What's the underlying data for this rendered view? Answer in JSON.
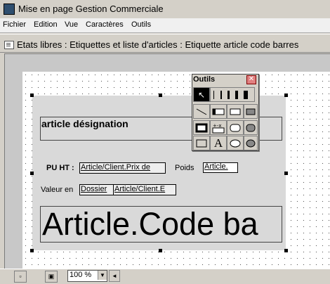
{
  "app": {
    "title": "Mise en page Gestion Commerciale"
  },
  "menu": [
    "Fichier",
    "Edition",
    "Vue",
    "Caractères",
    "Outils"
  ],
  "document": {
    "title": "Etats libres : Etiquettes et liste d'articles : Etiquette article code barres"
  },
  "label": {
    "designation": "article désignation",
    "puht_label": "PU HT :",
    "prix_field": "Article/Client.Prix de",
    "poids_label": "Poids",
    "poids_field": "Article.",
    "valeur_label": "Valeur en",
    "dossier_field": "Dossier",
    "client_field": "Article/Client.E",
    "code_field": "Article.Code ba"
  },
  "toolbox": {
    "title": "Outils",
    "close": "✕"
  },
  "statusbar": {
    "zoom": "100 %"
  }
}
